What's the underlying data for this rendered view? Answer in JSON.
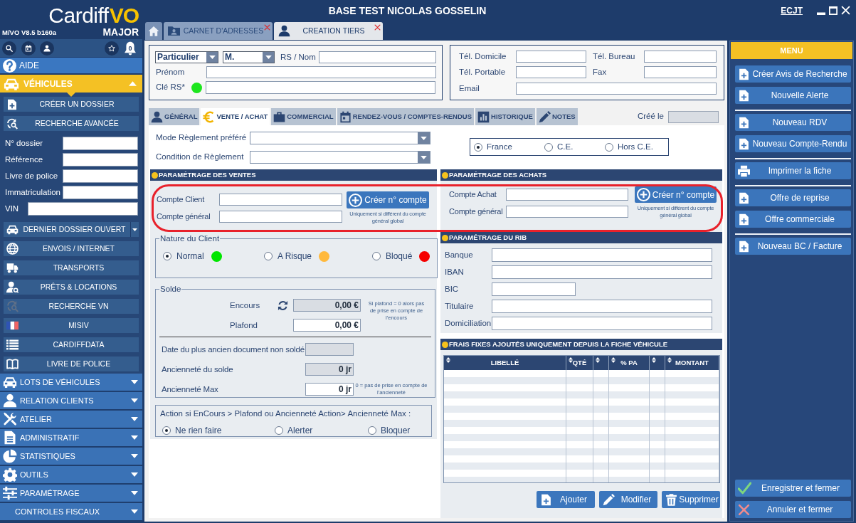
{
  "window": {
    "title": "BASE TEST NICOLAS GOSSELIN",
    "user": "ECJT"
  },
  "sidebar": {
    "logo": {
      "wordmark": "Cardiff",
      "accent": "VO",
      "subtitle": "MAJOR"
    },
    "version": "M/VO V8.5 b160a",
    "notification_count": "0",
    "help": "AIDE",
    "current_section": {
      "label": "VÉHICULES",
      "expanded": true
    },
    "actions": [
      {
        "label": "CRÉER UN DOSSIER"
      },
      {
        "label": "RECHERCHE AVANCÉE"
      }
    ],
    "search_fields": [
      {
        "label": "N° dossier",
        "kind": "short"
      },
      {
        "label": "Référence",
        "kind": "short"
      },
      {
        "label": "Livre de police",
        "kind": "short"
      },
      {
        "label": "Immatriculation",
        "kind": "short"
      },
      {
        "label": "VIN",
        "kind": "long"
      }
    ],
    "links": [
      {
        "label": "DERNIER DOSSIER OUVERT",
        "kind": "split"
      },
      {
        "label": "ENVOIS / INTERNET",
        "kind": "plain"
      },
      {
        "label": "TRANSPORTS",
        "kind": "plain"
      },
      {
        "label": "PRÊTS & LOCATIONS",
        "kind": "plain"
      },
      {
        "label": "RECHERCHE VN",
        "kind": "plain"
      },
      {
        "label": "MISIV",
        "kind": "plain"
      },
      {
        "label": "CARDIFFDATA",
        "kind": "plain"
      },
      {
        "label": "LIVRE DE POLICE",
        "kind": "plain"
      }
    ],
    "sections": [
      {
        "label": "LOTS DE VÉHICULES",
        "expanded": false
      },
      {
        "label": "RELATION CLIENTS",
        "expanded": false
      },
      {
        "label": "ATELIER",
        "expanded": false
      },
      {
        "label": "ADMINISTRATIF",
        "expanded": false
      },
      {
        "label": "STATISTIQUES",
        "expanded": false
      },
      {
        "label": "OUTILS",
        "expanded": false
      },
      {
        "label": "PARAMÉTRAGE",
        "expanded": false
      },
      {
        "label": "CONTROLES FISCAUX",
        "expanded": false
      }
    ]
  },
  "tabs": [
    {
      "kind": "home",
      "selected": false,
      "closable": false
    },
    {
      "kind": "page",
      "label": "CARNET D'ADRESSES",
      "selected": false,
      "closable": true
    },
    {
      "kind": "page",
      "label": "CREATION TIERS",
      "selected": true,
      "closable": true
    }
  ],
  "identity": {
    "type": "Particulier",
    "civility": "M.",
    "fields": [
      {
        "label": "RS / Nom"
      },
      {
        "label": "Prénom"
      },
      {
        "label": "Clé RS*",
        "color": "#1ee61e"
      }
    ]
  },
  "contact": {
    "fields": [
      {
        "label": "Tél. Domicile",
        "kind": "narrow"
      },
      {
        "label": "Tél. Bureau",
        "kind": "narrow"
      },
      {
        "label": "Tél. Portable",
        "kind": "narrow"
      },
      {
        "label": "Fax",
        "kind": "narrow"
      },
      {
        "label": "Email",
        "kind": "wide"
      }
    ]
  },
  "record_tabs": [
    {
      "label": "GÉNÉRAL",
      "selected": false
    },
    {
      "label": "VENTE / ACHAT",
      "selected": true
    },
    {
      "label": "COMMERCIAL",
      "selected": false
    },
    {
      "label": "RENDEZ-VOUS / COMPTES-RENDUS",
      "selected": false
    },
    {
      "label": "HISTORIQUE",
      "selected": false
    },
    {
      "label": "NOTES",
      "selected": false
    }
  ],
  "created": {
    "label": "Créé le"
  },
  "payment": {
    "fields": [
      {
        "label": "Mode Règlement préféré"
      },
      {
        "label": "Condition de Règlement"
      }
    ],
    "zones": [
      {
        "label": "France",
        "selected": true
      },
      {
        "label": "C.E.",
        "selected": false
      },
      {
        "label": "Hors C.E.",
        "selected": false
      }
    ]
  },
  "sales": {
    "title": "PARAMÉTRAGE DES VENTES",
    "fields": [
      {
        "label": "Compte Client"
      },
      {
        "label": "Compte général"
      }
    ],
    "button": "Créer n° compte",
    "note": "Uniquement si différent du compte général global",
    "customer_nature": {
      "legend": "Nature du Client",
      "options": [
        {
          "label": "Normal",
          "selected": true,
          "color": "#00e600"
        },
        {
          "label": "A Risque",
          "selected": false,
          "color": "#ffb93d"
        },
        {
          "label": "Bloqué",
          "selected": false,
          "color": "#f50000"
        }
      ]
    },
    "balance": {
      "legend": "Solde",
      "outstanding": {
        "label": "Encours",
        "value": "0,00 €"
      },
      "ceiling": {
        "label": "Plafond",
        "value": "0,00 €"
      },
      "ceiling_note": "Si plafond = 0 alors pas de prise en compte de l'encours",
      "oldest_document": {
        "label": "Date du plus ancien document non soldé"
      },
      "balance_age": {
        "label": "Ancienneté du solde",
        "value": "0 jr"
      },
      "max_age": {
        "label": "Ancienneté Max",
        "value": "0 jr"
      },
      "max_age_note": "0 = pas de prise en compte de l'ancienneté"
    },
    "overrun_action": {
      "label": "Action si EnCours > Plafond ou Ancienneté Action> Ancienneté Max :",
      "options": [
        {
          "label": "Ne rien faire",
          "selected": true
        },
        {
          "label": "Alerter",
          "selected": false
        },
        {
          "label": "Bloquer",
          "selected": false
        }
      ]
    }
  },
  "purchases": {
    "title": "PARAMÉTRAGE DES ACHATS",
    "fields": [
      {
        "label": "Compte Achat"
      },
      {
        "label": "Compte général"
      }
    ],
    "button": "Créer n° compte",
    "note": "Uniquement si différent du compte général global"
  },
  "rib": {
    "title": "PARAMÉTRAGE DU RIB",
    "fields": [
      {
        "label": "Banque",
        "kind": "wide"
      },
      {
        "label": "IBAN",
        "kind": "wide"
      },
      {
        "label": "BIC",
        "kind": "short"
      },
      {
        "label": "Titulaire",
        "kind": "wide"
      },
      {
        "label": "Domiciliation",
        "kind": "wide"
      }
    ]
  },
  "fees": {
    "title": "FRAIS FIXES AJOUTÉS UNIQUEMENT DEPUIS LA FICHE VÉHICULE",
    "columns": [
      {
        "kind": "labeled",
        "label": "LIBELLÉ"
      },
      {
        "kind": "labeled",
        "label": "QTÉ"
      },
      {
        "kind": "unlabeled"
      },
      {
        "kind": "labeled",
        "label": "% PA"
      },
      {
        "kind": "unlabeled"
      },
      {
        "kind": "labeled",
        "label": "MONTANT"
      }
    ],
    "buttons": [
      {
        "label": "Ajouter",
        "kind": "add"
      },
      {
        "label": "Modifier",
        "kind": "edit"
      },
      {
        "label": "Supprimer",
        "kind": "delete"
      }
    ]
  },
  "menu": {
    "title": "MENU",
    "groups": [
      [
        {
          "label": "Créer Avis de Recherche",
          "kind": "create"
        },
        {
          "label": "Nouvelle Alerte",
          "kind": "create"
        }
      ],
      [
        {
          "label": "Nouveau RDV",
          "kind": "create"
        },
        {
          "label": "Nouveau Compte-Rendu",
          "kind": "create"
        }
      ],
      [
        {
          "label": "Imprimer la fiche",
          "kind": "print"
        }
      ],
      [
        {
          "label": "Offre de reprise",
          "kind": "create"
        },
        {
          "label": "Offre commerciale",
          "kind": "create"
        }
      ],
      [
        {
          "label": "Nouveau BC / Facture",
          "kind": "create"
        }
      ]
    ],
    "footer": [
      {
        "label": "Enregistrer et fermer",
        "kind": "confirm"
      },
      {
        "label": "Annuler et fermer",
        "kind": "cancel"
      }
    ]
  }
}
